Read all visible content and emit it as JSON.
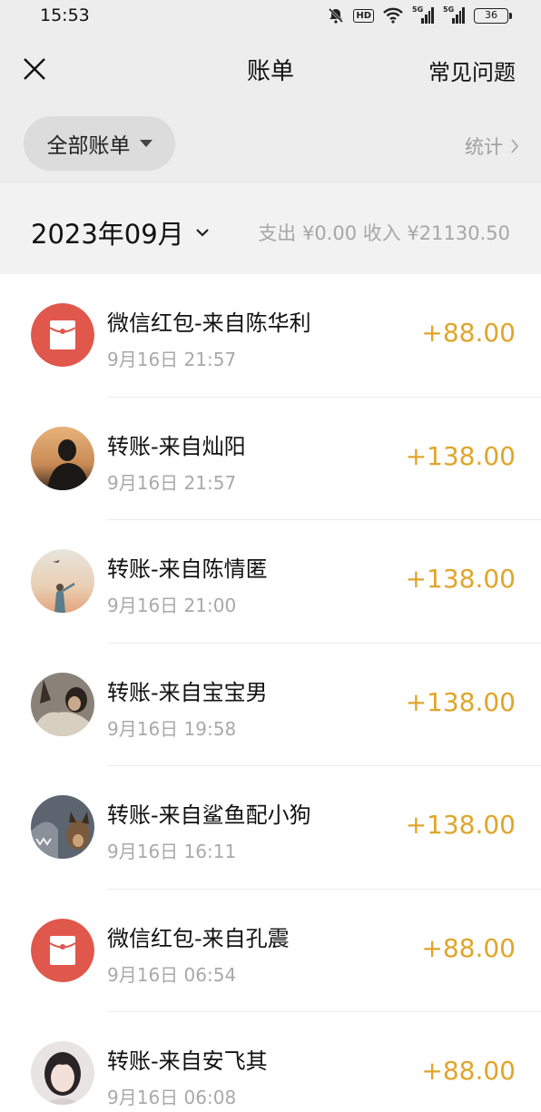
{
  "status_bar": {
    "time": "15:53",
    "hd_label": "HD",
    "signal_1_label": "5G",
    "signal_2_label": "5G",
    "battery_level": "36"
  },
  "nav": {
    "title": "账单",
    "faq_label": "常见问题"
  },
  "filter": {
    "label": "全部账单",
    "stats_label": "统计"
  },
  "month": {
    "label": "2023年09月",
    "summary": "支出 ¥0.00 收入 ¥21130.50"
  },
  "colors": {
    "amount": "#e0a52a",
    "red_packet": "#e0574b"
  },
  "transactions": [
    {
      "title": "微信红包-来自陈华利",
      "time": "9月16日 21:57",
      "amount": "+88.00",
      "icon": "red-packet-icon"
    },
    {
      "title": "转账-来自灿阳",
      "time": "9月16日 21:57",
      "amount": "+138.00",
      "icon": "avatar"
    },
    {
      "title": "转账-来自陈情匿",
      "time": "9月16日 21:00",
      "amount": "+138.00",
      "icon": "avatar"
    },
    {
      "title": "转账-来自宝宝男",
      "time": "9月16日 19:58",
      "amount": "+138.00",
      "icon": "avatar"
    },
    {
      "title": "转账-来自鲨鱼配小狗",
      "time": "9月16日 16:11",
      "amount": "+138.00",
      "icon": "avatar"
    },
    {
      "title": "微信红包-来自孔震",
      "time": "9月16日 06:54",
      "amount": "+88.00",
      "icon": "red-packet-icon"
    },
    {
      "title": "转账-来自安飞其",
      "time": "9月16日 06:08",
      "amount": "+88.00",
      "icon": "avatar"
    }
  ]
}
